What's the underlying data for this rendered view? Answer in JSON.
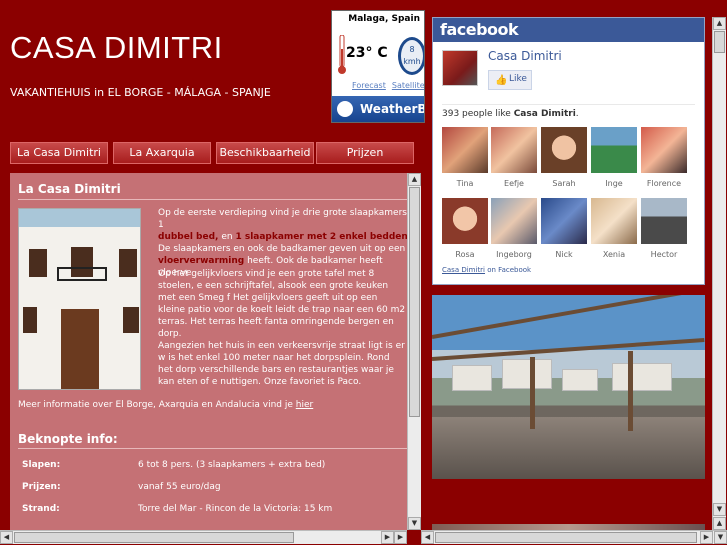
{
  "header": {
    "title": "CASA DIMITRI",
    "subtitle": "VAKANTIEHUIS in EL BORGE - MÁLAGA - SPANJE"
  },
  "weather": {
    "city": "Malaga, Spain",
    "temperature": "23° C",
    "wind": "8",
    "wind_unit": "kmh",
    "links": [
      "Forecast",
      "Satellite"
    ],
    "brand": "WeatherBug"
  },
  "nav": {
    "items": [
      "La Casa Dimitri",
      "La Axarquia",
      "Beschikbaarheid",
      "Prijzen"
    ]
  },
  "main": {
    "section_title": "La Casa Dimitri",
    "para1_a": "Op de eerste verdieping vind je drie grote slaapkamers: 1",
    "para1_b1": "dubbel bed,",
    "para1_c": " en ",
    "para1_b2": "1 slaapkamer met 2 enkel bedden",
    "para1_d": "De slaapkamers en ook de badkamer geven uit op een h",
    "para1_b3": "vloerverwarming",
    "para1_e": " heeft. Ook de badkamer heeft vloerve",
    "para2": "Op het gelijkvloers vind je een grote tafel met 8 stoelen, e een schrijftafel, alsook een grote keuken met een Smeg f Het gelijkvloers geeft uit op een kleine patio voor de koelt leidt de trap naar een 60 m2 terras. Het terras heeft fanta omringende bergen en dorp.",
    "para3": "Aangezien het huis in een verkeersvrije straat ligt is er w is het enkel 100 meter naar het dorpsplein. Rond het dorp verschillende bars en restaurantjes waar je kan eten of e nuttigen. Onze favoriet is Paco.",
    "more_info_prefix": "Meer informatie over El Borge, Axarquia en Andalucia vind je ",
    "more_info_link": "hier",
    "info_title": "Beknopte info:",
    "info_rows": [
      {
        "key": "Slapen:",
        "value": "6 tot 8 pers. (3 slaapkamers + extra bed)"
      },
      {
        "key": "Prijzen:",
        "value": "vanaf 55 euro/dag"
      },
      {
        "key": "Strand:",
        "value": "Torre del Mar - Rincon de la Victoria: 15 km"
      }
    ]
  },
  "facebook": {
    "brand": "facebook",
    "page_name": "Casa Dimitri",
    "like_label": "Like",
    "count_prefix": "393 people like ",
    "count_page": "Casa Dimitri",
    "count_suffix": ".",
    "fans": [
      "Tina",
      "Eefje",
      "Sarah",
      "Inge",
      "Florence",
      "Rosa",
      "Ingeborg",
      "Nick",
      "Xenia",
      "Hector"
    ],
    "footer_link": "Casa Dimitri",
    "footer_text": " on Facebook"
  }
}
